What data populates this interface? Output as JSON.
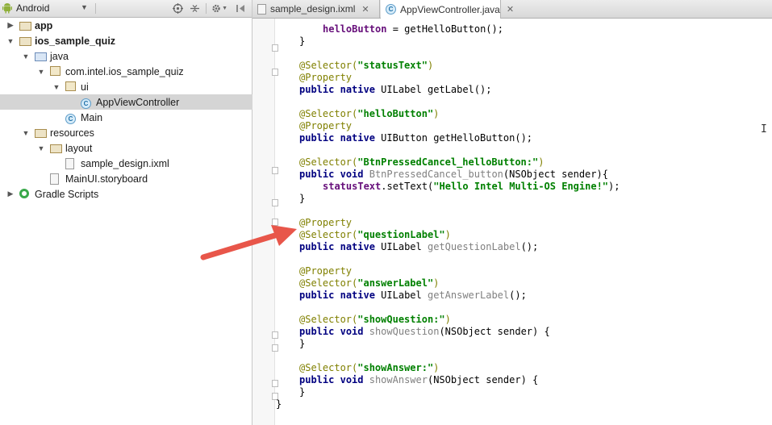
{
  "toolbar": {
    "view_label": "Android",
    "icons": [
      "android-icon",
      "dropdown-icon",
      "target-icon",
      "collapse-icon",
      "gear-icon",
      "hide-icon"
    ]
  },
  "tree": [
    {
      "label": "app",
      "icon": "folder",
      "expanded": false,
      "bold": true
    },
    {
      "label": "ios_sample_quiz",
      "icon": "folder",
      "expanded": true,
      "bold": true
    },
    {
      "label": "java",
      "icon": "source-folder",
      "expanded": true
    },
    {
      "label": "com.intel.ios_sample_quiz",
      "icon": "package",
      "expanded": true
    },
    {
      "label": "ui",
      "icon": "package",
      "expanded": true
    },
    {
      "label": "AppViewController",
      "icon": "class",
      "selected": true
    },
    {
      "label": "Main",
      "icon": "class"
    },
    {
      "label": "resources",
      "icon": "folder",
      "expanded": true
    },
    {
      "label": "layout",
      "icon": "folder",
      "expanded": true
    },
    {
      "label": "sample_design.ixml",
      "icon": "file"
    },
    {
      "label": "MainUI.storyboard",
      "icon": "file"
    },
    {
      "label": "Gradle Scripts",
      "icon": "gradle",
      "expanded": false
    }
  ],
  "tabs": [
    {
      "label": "sample_design.ixml",
      "active": false
    },
    {
      "label": "AppViewController.java",
      "active": true
    }
  ],
  "code": {
    "l0_field": "helloButton",
    "l0_rest": " = getHelloButton();",
    "brace_close": "}",
    "sel": "@Selector(",
    "prop": "@Property",
    "paren_close": ")",
    "public": "public",
    "native": "native",
    "void": "void",
    "s_statusText": "\"statusText\"",
    "t_uilabel": " UILabel ",
    "m_getLabel": "getLabel();",
    "s_helloButton": "\"helloButton\"",
    "t_uibutton": " UIButton ",
    "m_getHelloButton": "getHelloButton();",
    "s_btnPressed": "\"BtnPressedCancel_helloButton:\"",
    "m_btnPressed": "BtnPressedCancel_button",
    "p_sender_open": "(NSObject sender){",
    "f_statusText": "statusText",
    "m_setText_open": ".setText(",
    "s_hello": "\"Hello Intel Multi-OS Engine!\"",
    "m_setText_close": ");",
    "s_questionLabel": "\"questionLabel\"",
    "m_getQuestionLabel": "getQuestionLabel",
    "paren_semi": "();",
    "s_answerLabel": "\"answerLabel\"",
    "m_getAnswerLabel": "getAnswerLabel",
    "s_showQuestion": "\"showQuestion:\"",
    "m_showQuestion": "showQuestion",
    "p_sender_space": "(NSObject sender) {",
    "s_showAnswer": "\"showAnswer:\"",
    "m_showAnswer": "showAnswer"
  },
  "colors": {
    "annotation": "#808000",
    "keyword": "#000080",
    "string": "#008000",
    "field": "#660e7a",
    "unused": "#808080",
    "arrow": "#e8564a",
    "selection": "#d5d5d5"
  }
}
